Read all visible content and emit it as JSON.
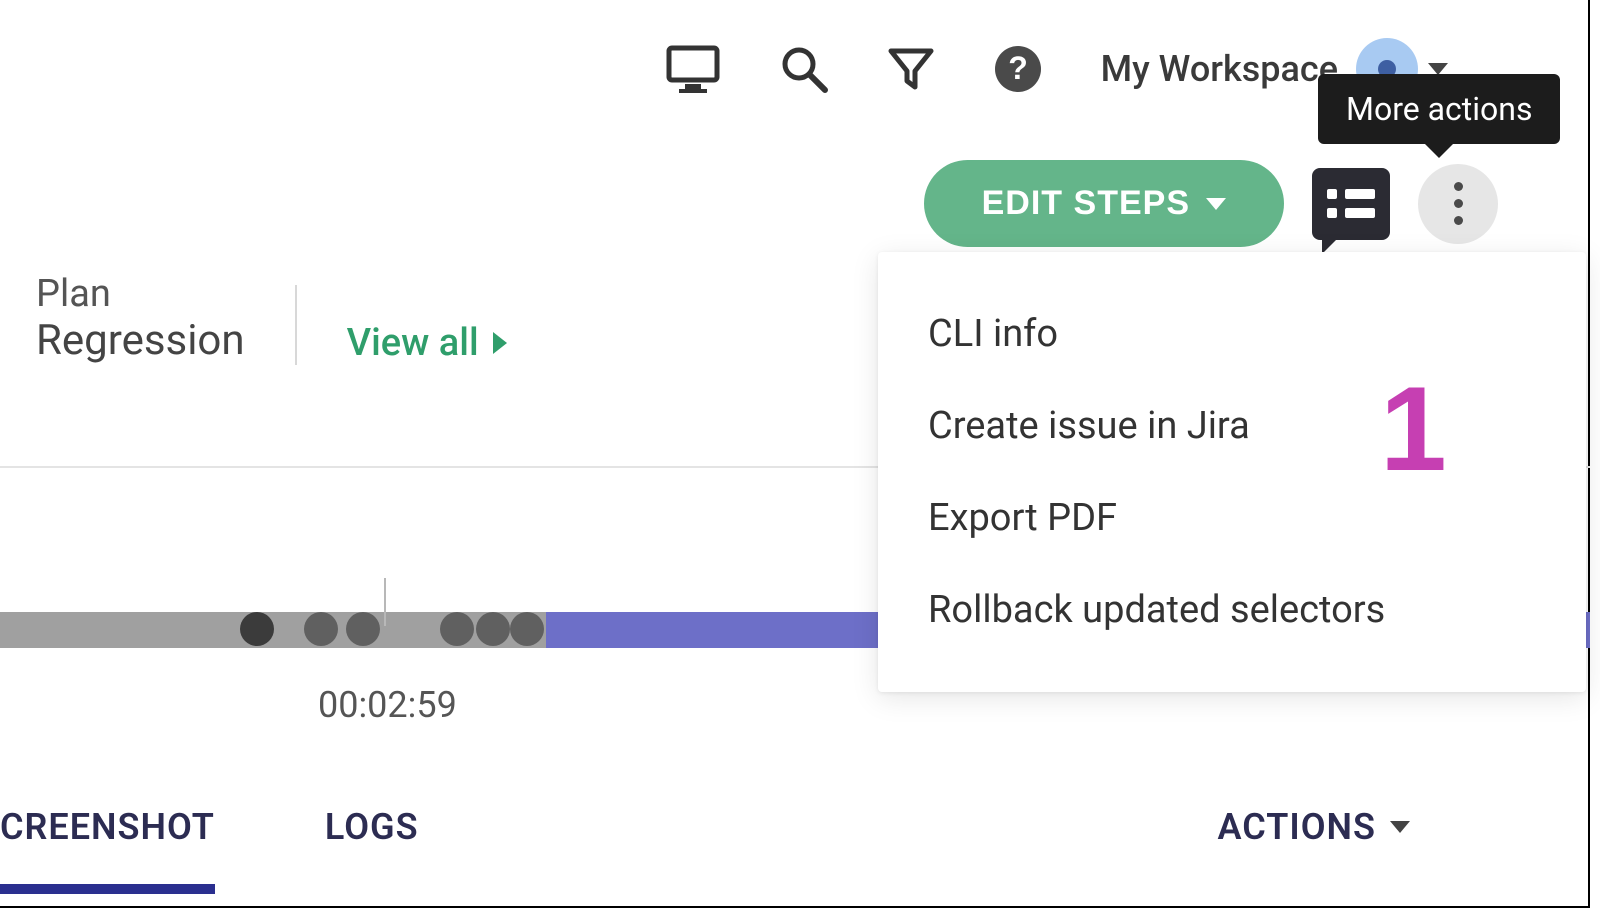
{
  "header": {
    "workspace_label": "My Workspace",
    "tooltip_more_actions": "More actions"
  },
  "actions": {
    "edit_steps_label": "EDIT STEPS"
  },
  "meta": {
    "plan_label": "Plan",
    "plan_value": "Regression",
    "view_all_label": "View all"
  },
  "timeline": {
    "time_label": "00:02:59"
  },
  "tabs": {
    "screenshot_label": "CREENSHOT",
    "logs_label": "LOGS",
    "actions_label": "ACTIONS"
  },
  "dropdown": {
    "items": [
      "CLI info",
      "Create issue in Jira",
      "Export PDF",
      "Rollback updated selectors"
    ]
  },
  "annotation": {
    "number": "1"
  }
}
